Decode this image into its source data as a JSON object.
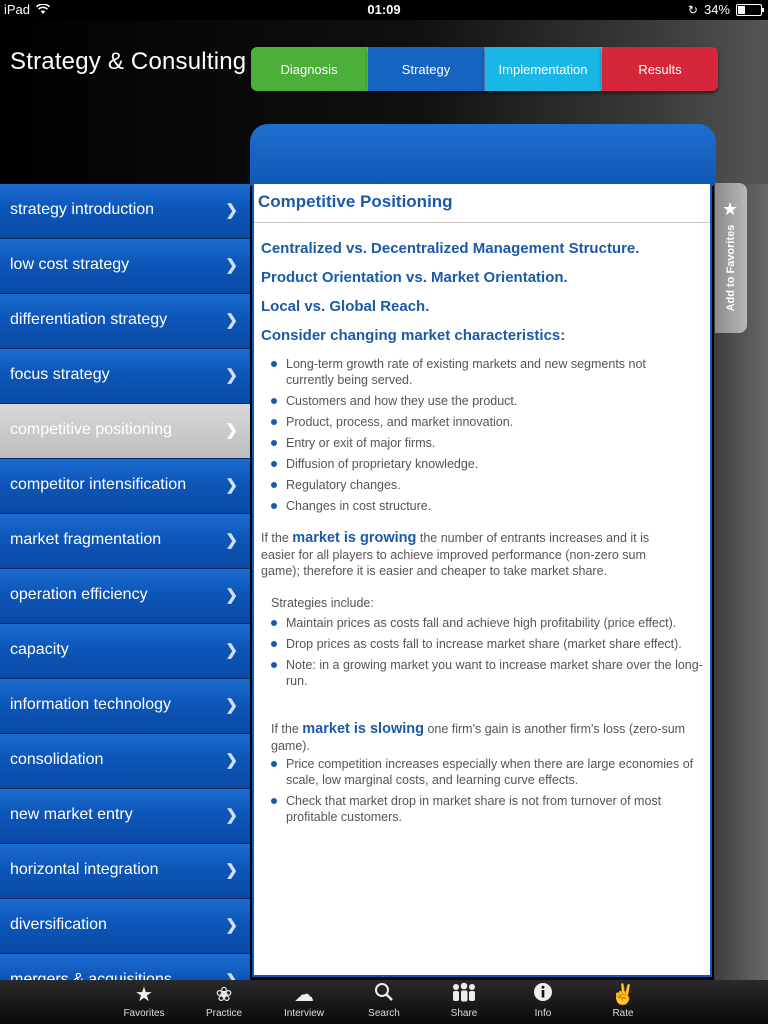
{
  "status": {
    "device": "iPad",
    "time": "01:09",
    "battery": "34%",
    "battery_level": 0.34
  },
  "header": {
    "title": "Strategy & Consulting"
  },
  "tabs": [
    {
      "label": "Diagnosis",
      "color": "#4caf3a"
    },
    {
      "label": "Strategy",
      "color": "#1565c0"
    },
    {
      "label": "Implementation",
      "color": "#19b6e6"
    },
    {
      "label": "Results",
      "color": "#d5263a"
    }
  ],
  "favorites": {
    "label": "Add to Favorites"
  },
  "sidebar": {
    "active_index": 4,
    "items": [
      "strategy introduction",
      "low cost strategy",
      "differentiation strategy",
      "focus strategy",
      "competitive positioning",
      "competitor intensification",
      "market fragmentation",
      "operation efficiency",
      "capacity",
      "information technology",
      "consolidation",
      "new market entry",
      "horizontal integration",
      "diversification",
      "mergers & acquisitions"
    ]
  },
  "content": {
    "title": "Competitive Positioning",
    "headings": [
      "Centralized vs. Decentralized Management Structure.",
      "Product Orientation vs. Market Orientation.",
      "Local vs. Global Reach.",
      "Consider changing market characteristics:"
    ],
    "market_bullets": [
      "Long-term growth rate of existing markets and new segments not currently being served.",
      "Customers and how they use the product.",
      "Product, process, and market innovation.",
      "Entry or exit of major firms.",
      "Diffusion of proprietary knowledge.",
      "Regulatory changes.",
      "Changes in cost structure."
    ],
    "growing": {
      "prefix": "If the ",
      "emphasis": "market is growing",
      "text": " the number of entrants increases and it is easier for all players to achieve improved performance (non-zero sum game); therefore it is easier and cheaper to take market share."
    },
    "strategies_label": "Strategies include:",
    "strategy_bullets": [
      "Maintain prices as costs fall and achieve high profitability (price effect).",
      "Drop prices as costs fall to increase market share (market share effect).",
      "Note: in a growing market you want to increase market share over the long-run."
    ],
    "slowing": {
      "prefix": "If the ",
      "emphasis": "market is slowing",
      "text": " one firm's gain is another firm's loss (zero-sum game)."
    },
    "slowing_bullets": [
      "Price competition increases especially when there are large economies of scale, low marginal costs, and learning curve effects.",
      "Check that market drop in market share is not from turnover of most profitable customers."
    ]
  },
  "tabbar": [
    {
      "label": "Favorites",
      "icon": "star-icon"
    },
    {
      "label": "Practice",
      "icon": "brain-icon"
    },
    {
      "label": "Interview",
      "icon": "chat-icon"
    },
    {
      "label": "Search",
      "icon": "search-icon"
    },
    {
      "label": "Share",
      "icon": "people-icon"
    },
    {
      "label": "Info",
      "icon": "info-icon"
    },
    {
      "label": "Rate",
      "icon": "thumbs-up-icon"
    }
  ]
}
